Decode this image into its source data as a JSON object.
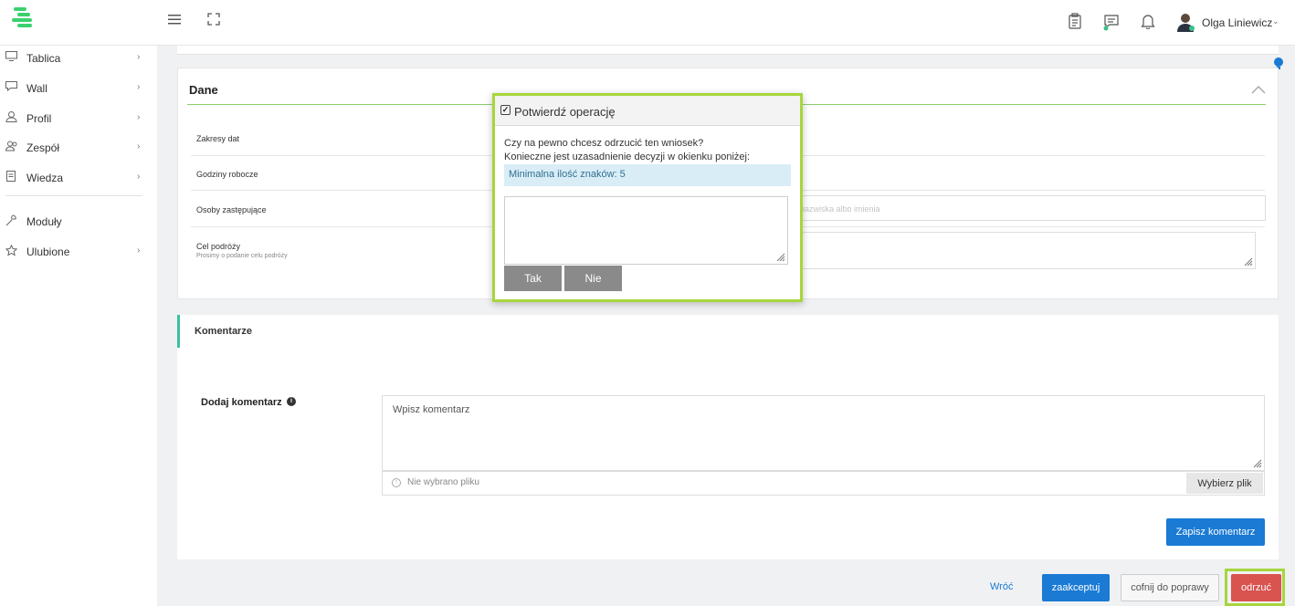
{
  "header": {
    "user_name": "Olga Liniewicz",
    "icons": [
      "menu-icon",
      "fullscreen-icon",
      "clipboard-icon",
      "messages-icon",
      "bell-icon"
    ]
  },
  "sidebar": {
    "items": [
      {
        "label": "Tablica",
        "icon": "monitor-icon"
      },
      {
        "label": "Wall",
        "icon": "chat-icon"
      },
      {
        "label": "Profil",
        "icon": "user-icon"
      },
      {
        "label": "Zespół",
        "icon": "team-icon"
      },
      {
        "label": "Wiedza",
        "icon": "book-icon"
      },
      {
        "label": "Moduły",
        "icon": "wrench-icon"
      },
      {
        "label": "Ulubione",
        "icon": "star-icon"
      }
    ]
  },
  "dane": {
    "title": "Dane",
    "rows": [
      {
        "label": "Zakresy dat"
      },
      {
        "label": "Godziny robocze"
      },
      {
        "label": "Osoby zastępujące",
        "placeholder": "nazwiska albo imienia"
      },
      {
        "label": "Cel podróży",
        "hint": "Prosimy o podanie celu podróży"
      }
    ]
  },
  "komentarze": {
    "title": "Komentarze",
    "add_label": "Dodaj komentarz",
    "comment_placeholder": "Wpisz komentarz",
    "no_file": "Nie wybrano pliku",
    "choose_file": "Wybierz plik",
    "save": "Zapisz komentarz"
  },
  "actions": {
    "back": "Wróć",
    "accept": "zaakceptuj",
    "return": "cofnij do poprawy",
    "reject": "odrzuć"
  },
  "modal": {
    "title": "Potwierdź operację",
    "question": "Czy na pewno chcesz odrzucić ten wniosek?",
    "note": "Konieczne jest uzasadnienie decyzji w okienku poniżej:",
    "alert": "Minimalna ilość znaków: 5",
    "yes": "Tak",
    "no": "Nie"
  },
  "colors": {
    "brand": "#3bd16f",
    "highlight": "#a7d63c",
    "primary": "#1a7ad4",
    "danger": "#d9534f"
  }
}
